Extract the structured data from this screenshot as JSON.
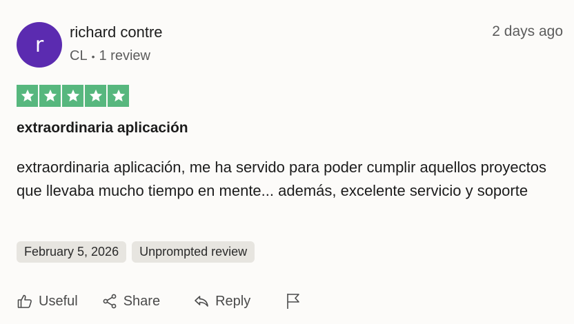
{
  "reviewer": {
    "avatar_letter": "r",
    "name": "richard contre",
    "country": "CL",
    "review_count": "1 review"
  },
  "time_ago": "2 days ago",
  "rating": {
    "stars": 5,
    "max": 5,
    "color": "#57b77e"
  },
  "review": {
    "title": "extraordinaria aplicación",
    "body": "extraordinaria aplicación, me ha servido para poder cumplir aquellos proyectos que llevaba mucho tiempo en mente... además, excelente servicio y soporte"
  },
  "tags": {
    "date": "February 5, 2026",
    "type": "Unprompted review"
  },
  "actions": {
    "useful_label": "Useful",
    "share_label": "Share",
    "reply_label": "Reply"
  },
  "icons": [
    "star-icon",
    "thumbs-up-icon",
    "share-icon",
    "reply-icon",
    "flag-icon"
  ],
  "colors": {
    "avatar": "#5b2bb0",
    "star_bg": "#57b77e",
    "tag_bg": "#e7e5e0"
  }
}
